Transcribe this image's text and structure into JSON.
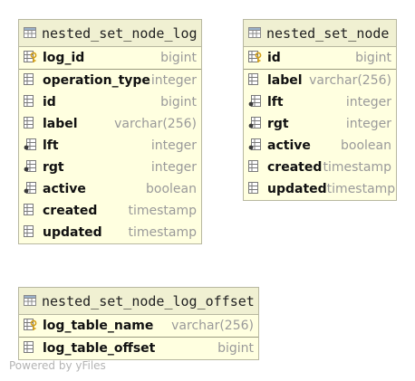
{
  "tables": [
    {
      "title": "nested_set_node_log",
      "columns": [
        {
          "name": "log_id",
          "type": "bigint",
          "icon": "primary-key-icon"
        },
        {
          "name": "operation_type",
          "type": "integer",
          "icon": "column-icon"
        },
        {
          "name": "id",
          "type": "bigint",
          "icon": "column-icon"
        },
        {
          "name": "label",
          "type": "varchar(256)",
          "icon": "column-icon"
        },
        {
          "name": "lft",
          "type": "integer",
          "icon": "nullable-column-icon"
        },
        {
          "name": "rgt",
          "type": "integer",
          "icon": "nullable-column-icon"
        },
        {
          "name": "active",
          "type": "boolean",
          "icon": "nullable-column-icon"
        },
        {
          "name": "created",
          "type": "timestamp",
          "icon": "column-icon"
        },
        {
          "name": "updated",
          "type": "timestamp",
          "icon": "column-icon"
        }
      ]
    },
    {
      "title": "nested_set_node",
      "columns": [
        {
          "name": "id",
          "type": "bigint",
          "icon": "primary-key-icon"
        },
        {
          "name": "label",
          "type": "varchar(256)",
          "icon": "column-icon"
        },
        {
          "name": "lft",
          "type": "integer",
          "icon": "nullable-column-icon"
        },
        {
          "name": "rgt",
          "type": "integer",
          "icon": "nullable-column-icon"
        },
        {
          "name": "active",
          "type": "boolean",
          "icon": "nullable-column-icon"
        },
        {
          "name": "created",
          "type": "timestamp",
          "icon": "column-icon"
        },
        {
          "name": "updated",
          "type": "timestamp",
          "icon": "column-icon"
        }
      ]
    },
    {
      "title": "nested_set_node_log_offset",
      "columns": [
        {
          "name": "log_table_name",
          "type": "varchar(256)",
          "icon": "primary-key-icon"
        },
        {
          "name": "log_table_offset",
          "type": "bigint",
          "icon": "column-icon"
        }
      ]
    }
  ],
  "watermark": "Powered by yFiles",
  "colors": {
    "table_fill": "#ffffe0",
    "header_fill": "#f0f0d2",
    "border": "#b8b8a0",
    "key_gold": "#d4a017"
  }
}
